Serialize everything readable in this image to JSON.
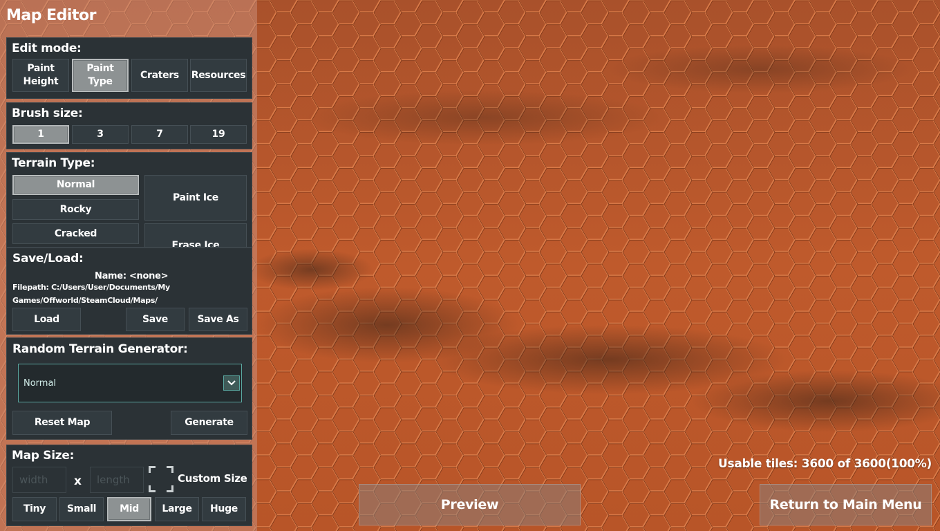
{
  "window_title": "Map Editor",
  "edit_mode": {
    "label": "Edit mode:",
    "buttons": [
      {
        "line1": "Paint",
        "line2": "Height",
        "selected": false
      },
      {
        "line1": "Paint",
        "line2": "Type",
        "selected": true
      },
      {
        "line1": "Craters",
        "line2": "",
        "selected": false
      },
      {
        "line1": "Resources",
        "line2": "",
        "selected": false
      }
    ]
  },
  "brush_size": {
    "label": "Brush size:",
    "options": [
      "1",
      "3",
      "7",
      "19"
    ],
    "selected": "1"
  },
  "terrain_type": {
    "label": "Terrain Type:",
    "types": [
      "Normal",
      "Rocky",
      "Cracked"
    ],
    "selected": "Normal",
    "paint_ice_label": "Paint Ice",
    "erase_ice_label": "Erase Ice"
  },
  "save_load": {
    "label": "Save/Load:",
    "name_text": "Name: <none>",
    "filepath_line1": "Filepath: C:/Users/User/Documents/My",
    "filepath_line2": "Games/Offworld/SteamCloud/Maps/",
    "load_label": "Load",
    "save_label": "Save",
    "save_as_label": "Save As"
  },
  "random_generator": {
    "label": "Random Terrain Generator:",
    "selected_option": "Normal",
    "reset_label": "Reset Map",
    "generate_label": "Generate"
  },
  "map_size": {
    "label": "Map Size:",
    "width_placeholder": "width",
    "length_placeholder": "length",
    "times": "x",
    "custom_size_label": "Custom Size",
    "sizes": [
      "Tiny",
      "Small",
      "Mid",
      "Large",
      "Huge"
    ],
    "selected": "Mid"
  },
  "usable_tiles": "Usable tiles: 3600 of 3600(100%)",
  "preview_label": "Preview",
  "return_label": "Return to Main Menu",
  "colors": {
    "terrain": "#b8562a",
    "panel": "#2b3236",
    "selected_button": "#8d9293",
    "dropdown_border": "#5aa7a0"
  }
}
